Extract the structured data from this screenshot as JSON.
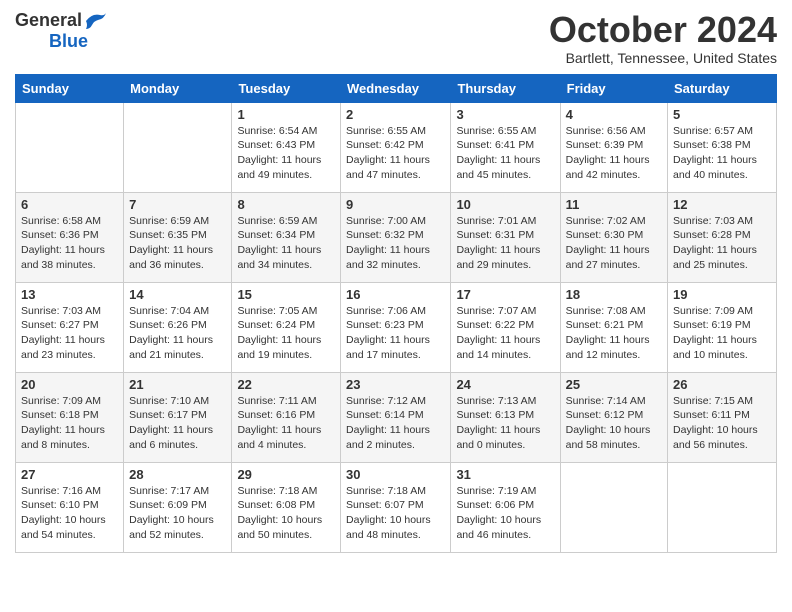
{
  "header": {
    "logo_general": "General",
    "logo_blue": "Blue",
    "month_title": "October 2024",
    "location": "Bartlett, Tennessee, United States"
  },
  "days_of_week": [
    "Sunday",
    "Monday",
    "Tuesday",
    "Wednesday",
    "Thursday",
    "Friday",
    "Saturday"
  ],
  "weeks": [
    [
      {
        "day": "",
        "info": ""
      },
      {
        "day": "",
        "info": ""
      },
      {
        "day": "1",
        "info": "Sunrise: 6:54 AM\nSunset: 6:43 PM\nDaylight: 11 hours and 49 minutes."
      },
      {
        "day": "2",
        "info": "Sunrise: 6:55 AM\nSunset: 6:42 PM\nDaylight: 11 hours and 47 minutes."
      },
      {
        "day": "3",
        "info": "Sunrise: 6:55 AM\nSunset: 6:41 PM\nDaylight: 11 hours and 45 minutes."
      },
      {
        "day": "4",
        "info": "Sunrise: 6:56 AM\nSunset: 6:39 PM\nDaylight: 11 hours and 42 minutes."
      },
      {
        "day": "5",
        "info": "Sunrise: 6:57 AM\nSunset: 6:38 PM\nDaylight: 11 hours and 40 minutes."
      }
    ],
    [
      {
        "day": "6",
        "info": "Sunrise: 6:58 AM\nSunset: 6:36 PM\nDaylight: 11 hours and 38 minutes."
      },
      {
        "day": "7",
        "info": "Sunrise: 6:59 AM\nSunset: 6:35 PM\nDaylight: 11 hours and 36 minutes."
      },
      {
        "day": "8",
        "info": "Sunrise: 6:59 AM\nSunset: 6:34 PM\nDaylight: 11 hours and 34 minutes."
      },
      {
        "day": "9",
        "info": "Sunrise: 7:00 AM\nSunset: 6:32 PM\nDaylight: 11 hours and 32 minutes."
      },
      {
        "day": "10",
        "info": "Sunrise: 7:01 AM\nSunset: 6:31 PM\nDaylight: 11 hours and 29 minutes."
      },
      {
        "day": "11",
        "info": "Sunrise: 7:02 AM\nSunset: 6:30 PM\nDaylight: 11 hours and 27 minutes."
      },
      {
        "day": "12",
        "info": "Sunrise: 7:03 AM\nSunset: 6:28 PM\nDaylight: 11 hours and 25 minutes."
      }
    ],
    [
      {
        "day": "13",
        "info": "Sunrise: 7:03 AM\nSunset: 6:27 PM\nDaylight: 11 hours and 23 minutes."
      },
      {
        "day": "14",
        "info": "Sunrise: 7:04 AM\nSunset: 6:26 PM\nDaylight: 11 hours and 21 minutes."
      },
      {
        "day": "15",
        "info": "Sunrise: 7:05 AM\nSunset: 6:24 PM\nDaylight: 11 hours and 19 minutes."
      },
      {
        "day": "16",
        "info": "Sunrise: 7:06 AM\nSunset: 6:23 PM\nDaylight: 11 hours and 17 minutes."
      },
      {
        "day": "17",
        "info": "Sunrise: 7:07 AM\nSunset: 6:22 PM\nDaylight: 11 hours and 14 minutes."
      },
      {
        "day": "18",
        "info": "Sunrise: 7:08 AM\nSunset: 6:21 PM\nDaylight: 11 hours and 12 minutes."
      },
      {
        "day": "19",
        "info": "Sunrise: 7:09 AM\nSunset: 6:19 PM\nDaylight: 11 hours and 10 minutes."
      }
    ],
    [
      {
        "day": "20",
        "info": "Sunrise: 7:09 AM\nSunset: 6:18 PM\nDaylight: 11 hours and 8 minutes."
      },
      {
        "day": "21",
        "info": "Sunrise: 7:10 AM\nSunset: 6:17 PM\nDaylight: 11 hours and 6 minutes."
      },
      {
        "day": "22",
        "info": "Sunrise: 7:11 AM\nSunset: 6:16 PM\nDaylight: 11 hours and 4 minutes."
      },
      {
        "day": "23",
        "info": "Sunrise: 7:12 AM\nSunset: 6:14 PM\nDaylight: 11 hours and 2 minutes."
      },
      {
        "day": "24",
        "info": "Sunrise: 7:13 AM\nSunset: 6:13 PM\nDaylight: 11 hours and 0 minutes."
      },
      {
        "day": "25",
        "info": "Sunrise: 7:14 AM\nSunset: 6:12 PM\nDaylight: 10 hours and 58 minutes."
      },
      {
        "day": "26",
        "info": "Sunrise: 7:15 AM\nSunset: 6:11 PM\nDaylight: 10 hours and 56 minutes."
      }
    ],
    [
      {
        "day": "27",
        "info": "Sunrise: 7:16 AM\nSunset: 6:10 PM\nDaylight: 10 hours and 54 minutes."
      },
      {
        "day": "28",
        "info": "Sunrise: 7:17 AM\nSunset: 6:09 PM\nDaylight: 10 hours and 52 minutes."
      },
      {
        "day": "29",
        "info": "Sunrise: 7:18 AM\nSunset: 6:08 PM\nDaylight: 10 hours and 50 minutes."
      },
      {
        "day": "30",
        "info": "Sunrise: 7:18 AM\nSunset: 6:07 PM\nDaylight: 10 hours and 48 minutes."
      },
      {
        "day": "31",
        "info": "Sunrise: 7:19 AM\nSunset: 6:06 PM\nDaylight: 10 hours and 46 minutes."
      },
      {
        "day": "",
        "info": ""
      },
      {
        "day": "",
        "info": ""
      }
    ]
  ]
}
